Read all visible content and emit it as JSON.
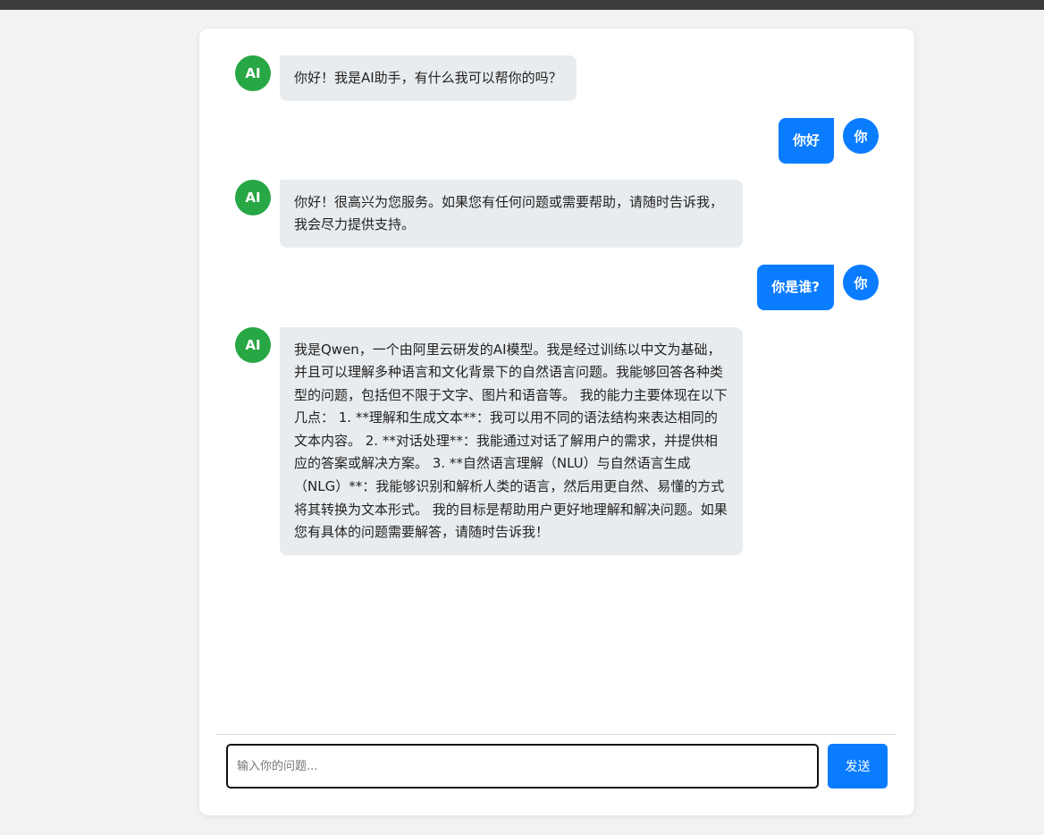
{
  "chat": {
    "messages": [
      {
        "role": "ai",
        "avatar": "AI",
        "text": "你好！我是AI助手，有什么我可以帮你的吗？"
      },
      {
        "role": "user",
        "avatar": "你",
        "text": "你好"
      },
      {
        "role": "ai",
        "avatar": "AI",
        "text": "你好！很高兴为您服务。如果您有任何问题或需要帮助，请随时告诉我，我会尽力提供支持。"
      },
      {
        "role": "user",
        "avatar": "你",
        "text": "你是谁?"
      },
      {
        "role": "ai",
        "avatar": "AI",
        "text": "我是Qwen，一个由阿里云研发的AI模型。我是经过训练以中文为基础，并且可以理解多种语言和文化背景下的自然语言问题。我能够回答各种类型的问题，包括但不限于文字、图片和语音等。 我的能力主要体现在以下几点： 1. **理解和生成文本**：我可以用不同的语法结构来表达相同的文本内容。 2. **对话处理**：我能通过对话了解用户的需求，并提供相应的答案或解决方案。 3. **自然语言理解（NLU）与自然语言生成（NLG）**：我能够识别和解析人类的语言，然后用更自然、易懂的方式将其转换为文本形式。 我的目标是帮助用户更好地理解和解决问题。如果您有具体的问题需要解答，请随时告诉我！"
      }
    ]
  },
  "input": {
    "placeholder": "输入你的问题...",
    "value": ""
  },
  "send_button": {
    "label": "发送"
  },
  "colors": {
    "ai_avatar": "#28a745",
    "user_accent": "#0a7cff",
    "ai_bubble": "#e9ecef"
  }
}
